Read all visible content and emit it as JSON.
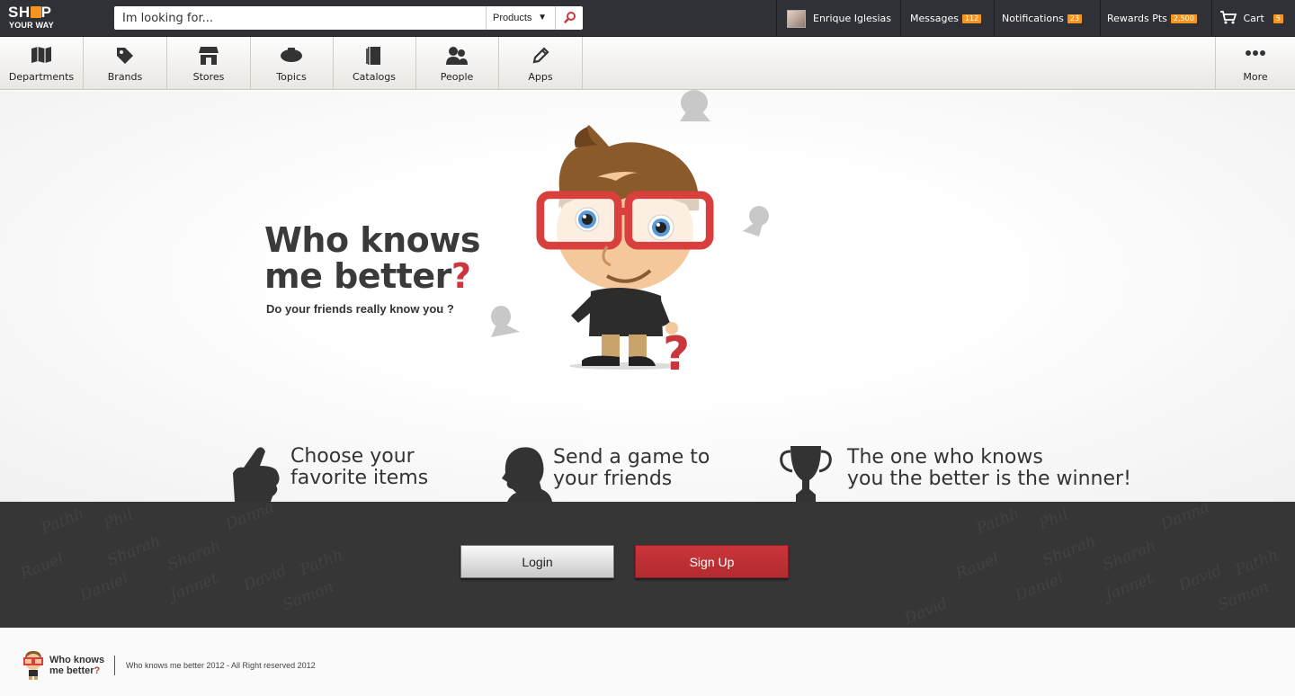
{
  "topbar": {
    "logo_line1_a": "SH",
    "logo_line1_b": "P",
    "logo_line2": "YOUR WAY",
    "search": {
      "placeholder": "Im looking for...",
      "category": "Products"
    },
    "user_name": "Enrique Iglesias",
    "messages": {
      "label": "Messages",
      "count": "112"
    },
    "notifications": {
      "label": "Notifications",
      "count": "23"
    },
    "rewards": {
      "label": "Rewards Pts",
      "count": "2,500"
    },
    "cart": {
      "label": "Cart",
      "count": "5"
    }
  },
  "nav": {
    "items": [
      "Departments",
      "Brands",
      "Stores",
      "Topics",
      "Catalogs",
      "People",
      "Apps"
    ],
    "more": "More"
  },
  "hero": {
    "title_line1": "Who knows",
    "title_line2": "me better",
    "title_q": "?",
    "subtitle": "Do your friends really know you ?"
  },
  "steps": [
    {
      "line1": "Choose your",
      "line2": "favorite items"
    },
    {
      "line1": "Send a game to",
      "line2": "your friends"
    },
    {
      "line1": "The one who knows",
      "line2": "you the better is the winner!"
    }
  ],
  "band": {
    "login_label": "Login",
    "signup_label": "Sign Up",
    "watermark_names": [
      "Pathh",
      "Phil",
      "Danna",
      "Sharah",
      "Sharah",
      "Rauel",
      "Daniel",
      "Jannet",
      "David",
      "Pathh",
      "Samon",
      "David"
    ]
  },
  "footer": {
    "logo_line1": "Who knows",
    "logo_line2": "me better",
    "logo_q": "?",
    "copyright": "Who knows me better 2012 - All Right reserved 2012"
  },
  "colors": {
    "topbar_bg": "#2f3136",
    "badge": "#f7941d",
    "accent_red": "#c9363b",
    "band_bg": "#363636"
  }
}
